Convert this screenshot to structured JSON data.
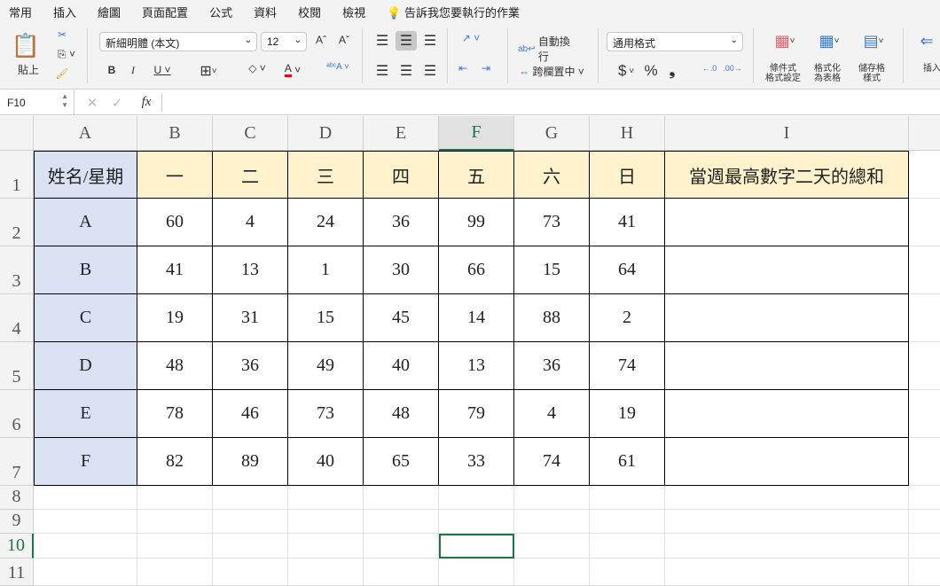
{
  "tabs": [
    "常用",
    "插入",
    "繪圖",
    "頁面配置",
    "公式",
    "資料",
    "校閱",
    "檢視"
  ],
  "tell_me": "告訴我您要執行的作業",
  "ribbon": {
    "paste": "貼上",
    "font_name": "新細明體 (本文)",
    "font_size": "12",
    "bold": "B",
    "italic": "I",
    "underline": "U",
    "wrap_text": "自動換行",
    "merge_center": "跨欄置中",
    "number_format": "通用格式",
    "currency": "$",
    "percent": "%",
    "comma": "❟",
    "cond_format": [
      "條件式",
      "格式設定"
    ],
    "format_table": [
      "格式化",
      "為表格"
    ],
    "cell_styles": [
      "儲存格",
      "樣式"
    ],
    "insert": "插入",
    "accent_fill": "#c5d5ea",
    "font_color": "#e00000"
  },
  "formula_bar": {
    "name_box": "F10",
    "fx": "fx",
    "value": ""
  },
  "columns": [
    "A",
    "B",
    "C",
    "D",
    "E",
    "F",
    "G",
    "H",
    "I"
  ],
  "rows": [
    "1",
    "2",
    "3",
    "4",
    "5",
    "6",
    "7",
    "8",
    "9",
    "10",
    "11"
  ],
  "selected_cell": "F10",
  "table": {
    "header": [
      "姓名/星期",
      "一",
      "二",
      "三",
      "四",
      "五",
      "六",
      "日",
      "當週最高數字二天的總和"
    ],
    "rows": [
      [
        "A",
        "60",
        "4",
        "24",
        "36",
        "99",
        "73",
        "41",
        ""
      ],
      [
        "B",
        "41",
        "13",
        "1",
        "30",
        "66",
        "15",
        "64",
        ""
      ],
      [
        "C",
        "19",
        "31",
        "15",
        "45",
        "14",
        "88",
        "2",
        ""
      ],
      [
        "D",
        "48",
        "36",
        "49",
        "40",
        "13",
        "36",
        "74",
        ""
      ],
      [
        "E",
        "78",
        "46",
        "73",
        "48",
        "79",
        "4",
        "19",
        ""
      ],
      [
        "F",
        "82",
        "89",
        "40",
        "65",
        "33",
        "74",
        "61",
        ""
      ]
    ]
  },
  "colors": {
    "header_fill": "#fff2cc",
    "name_fill": "#d9e1f2",
    "selection": "#217346"
  }
}
